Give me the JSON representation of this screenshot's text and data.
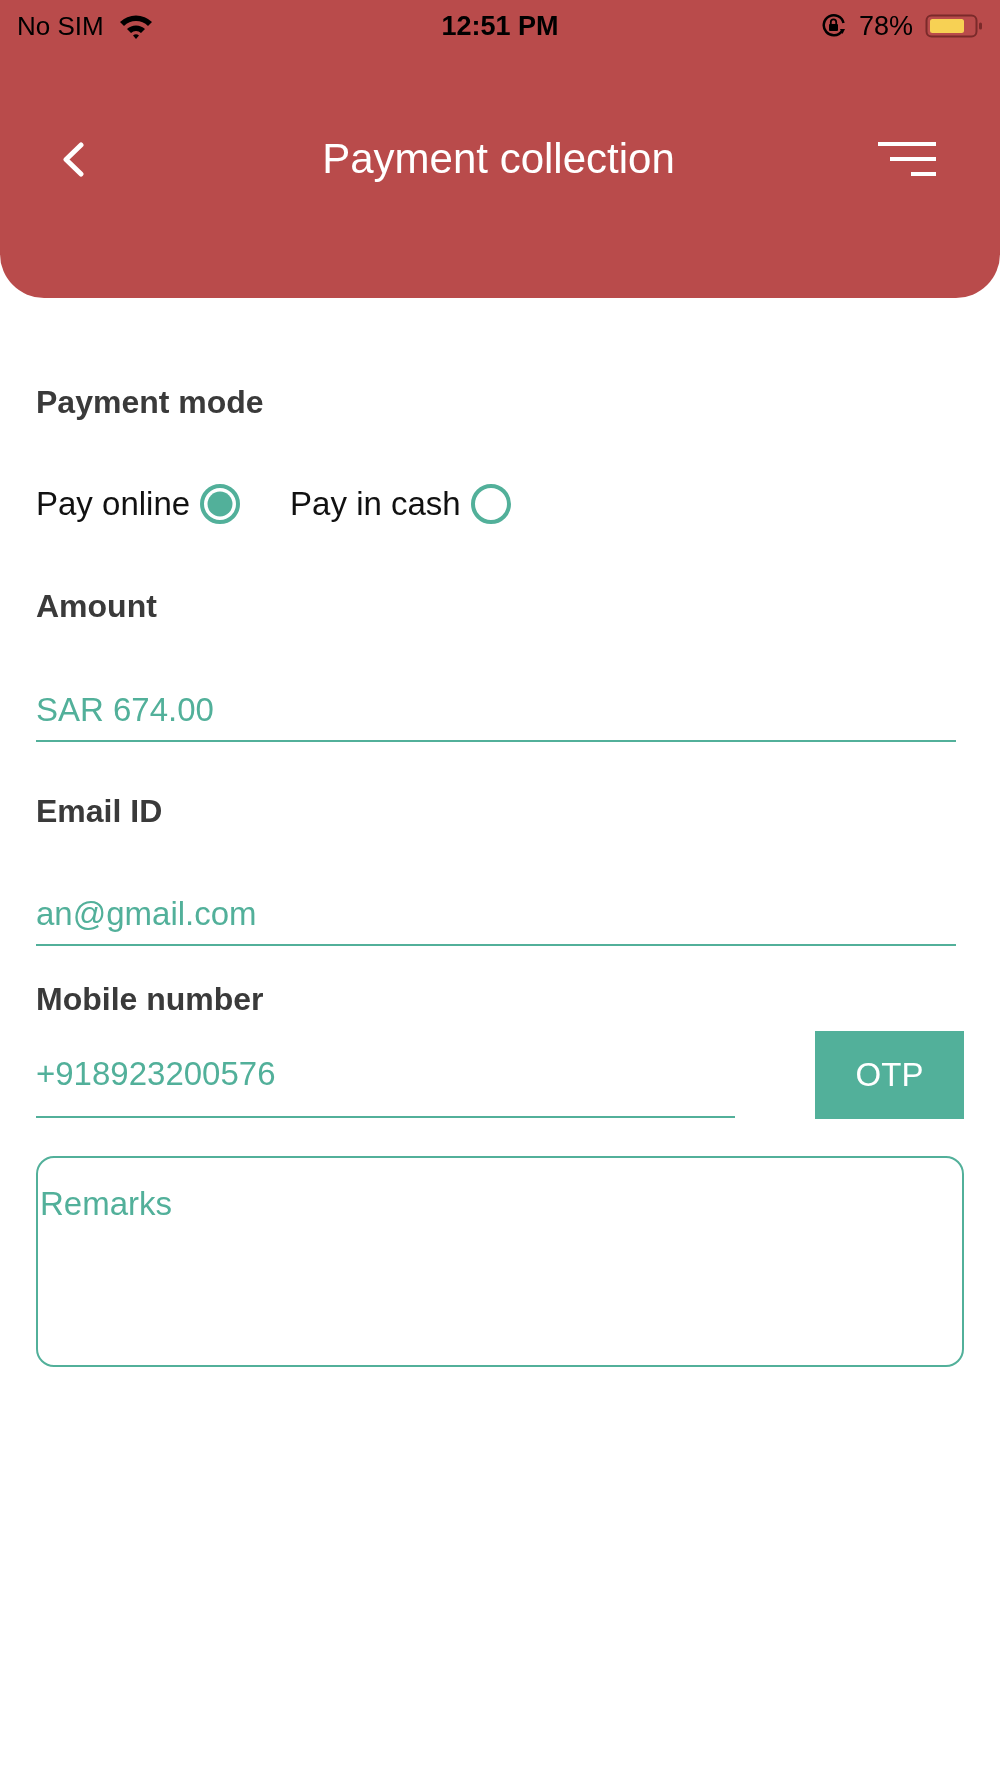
{
  "status_bar": {
    "carrier": "No SIM",
    "time": "12:51 PM",
    "battery": "78%"
  },
  "header": {
    "title": "Payment collection"
  },
  "payment_mode": {
    "label": "Payment mode",
    "options": [
      {
        "label": "Pay online",
        "selected": true
      },
      {
        "label": "Pay in cash",
        "selected": false
      }
    ]
  },
  "fields": [
    {
      "label": "Amount",
      "value": "SAR 674.00"
    },
    {
      "label": "Email ID",
      "value": "an@gmail.com"
    }
  ],
  "mobile": {
    "label": "Mobile number",
    "value": "+918923200576",
    "button": "OTP"
  },
  "remarks": {
    "placeholder": "Remarks"
  }
}
